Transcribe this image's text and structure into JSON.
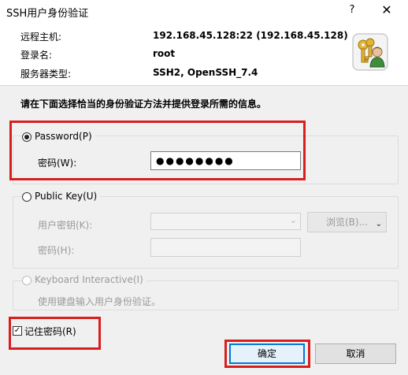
{
  "window": {
    "title": "SSH用户身份验证",
    "help_label": "?",
    "close_label": "✕"
  },
  "info": {
    "host_label": "远程主机:",
    "host_value": "192.168.45.128:22 (192.168.45.128)",
    "login_label": "登录名:",
    "login_value": "root",
    "server_type_label": "服务器类型:",
    "server_type_value": "SSH2, OpenSSH_7.4"
  },
  "instruction": "请在下面选择恰当的身份验证方法并提供登录所需的信息。",
  "password_method": {
    "label": "Password(P)",
    "selected": true,
    "field_label": "密码(W):",
    "field_value": "●●●●●●●●"
  },
  "publickey_method": {
    "label": "Public Key(U)",
    "selected": false,
    "key_label": "用户密钥(K):",
    "key_value": "",
    "browse_label": "浏览(B)...",
    "passphrase_label": "密码(H):",
    "passphrase_value": ""
  },
  "keyboard_method": {
    "label": "Keyboard Interactive(I)",
    "selected": false,
    "description": "使用键盘输入用户身份验证。"
  },
  "remember": {
    "label": "记住密码(R)",
    "checked": true,
    "check_mark": "✓"
  },
  "buttons": {
    "ok_label": "确定",
    "cancel_label": "取消"
  },
  "icons": {
    "window_icon": "keys-user-icon"
  },
  "colors": {
    "highlight": "#d91e1e",
    "focus_border": "#0078d7"
  }
}
